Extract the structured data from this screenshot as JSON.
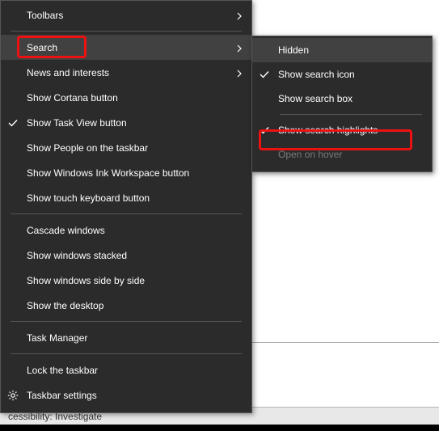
{
  "statusbar": {
    "text": "cessibility: Investigate"
  },
  "menu": {
    "toolbars": {
      "label": "Toolbars",
      "has_submenu": true
    },
    "search": {
      "label": "Search",
      "has_submenu": true,
      "hovered": true
    },
    "news": {
      "label": "News and interests",
      "has_submenu": true
    },
    "cortana": {
      "label": "Show Cortana button"
    },
    "taskview": {
      "label": "Show Task View button",
      "checked": true
    },
    "people": {
      "label": "Show People on the taskbar"
    },
    "ink": {
      "label": "Show Windows Ink Workspace button"
    },
    "touchkb": {
      "label": "Show touch keyboard button"
    },
    "cascade": {
      "label": "Cascade windows"
    },
    "stacked": {
      "label": "Show windows stacked"
    },
    "sidebyside": {
      "label": "Show windows side by side"
    },
    "desktop": {
      "label": "Show the desktop"
    },
    "taskmgr": {
      "label": "Task Manager"
    },
    "lock": {
      "label": "Lock the taskbar"
    },
    "settings": {
      "label": "Taskbar settings"
    }
  },
  "submenu": {
    "hidden": {
      "label": "Hidden",
      "hovered": true
    },
    "icon": {
      "label": "Show search icon",
      "checked": true
    },
    "box": {
      "label": "Show search box"
    },
    "highlights": {
      "label": "Show search highlights",
      "checked": true
    },
    "hover": {
      "label": "Open on hover",
      "disabled": true
    }
  }
}
